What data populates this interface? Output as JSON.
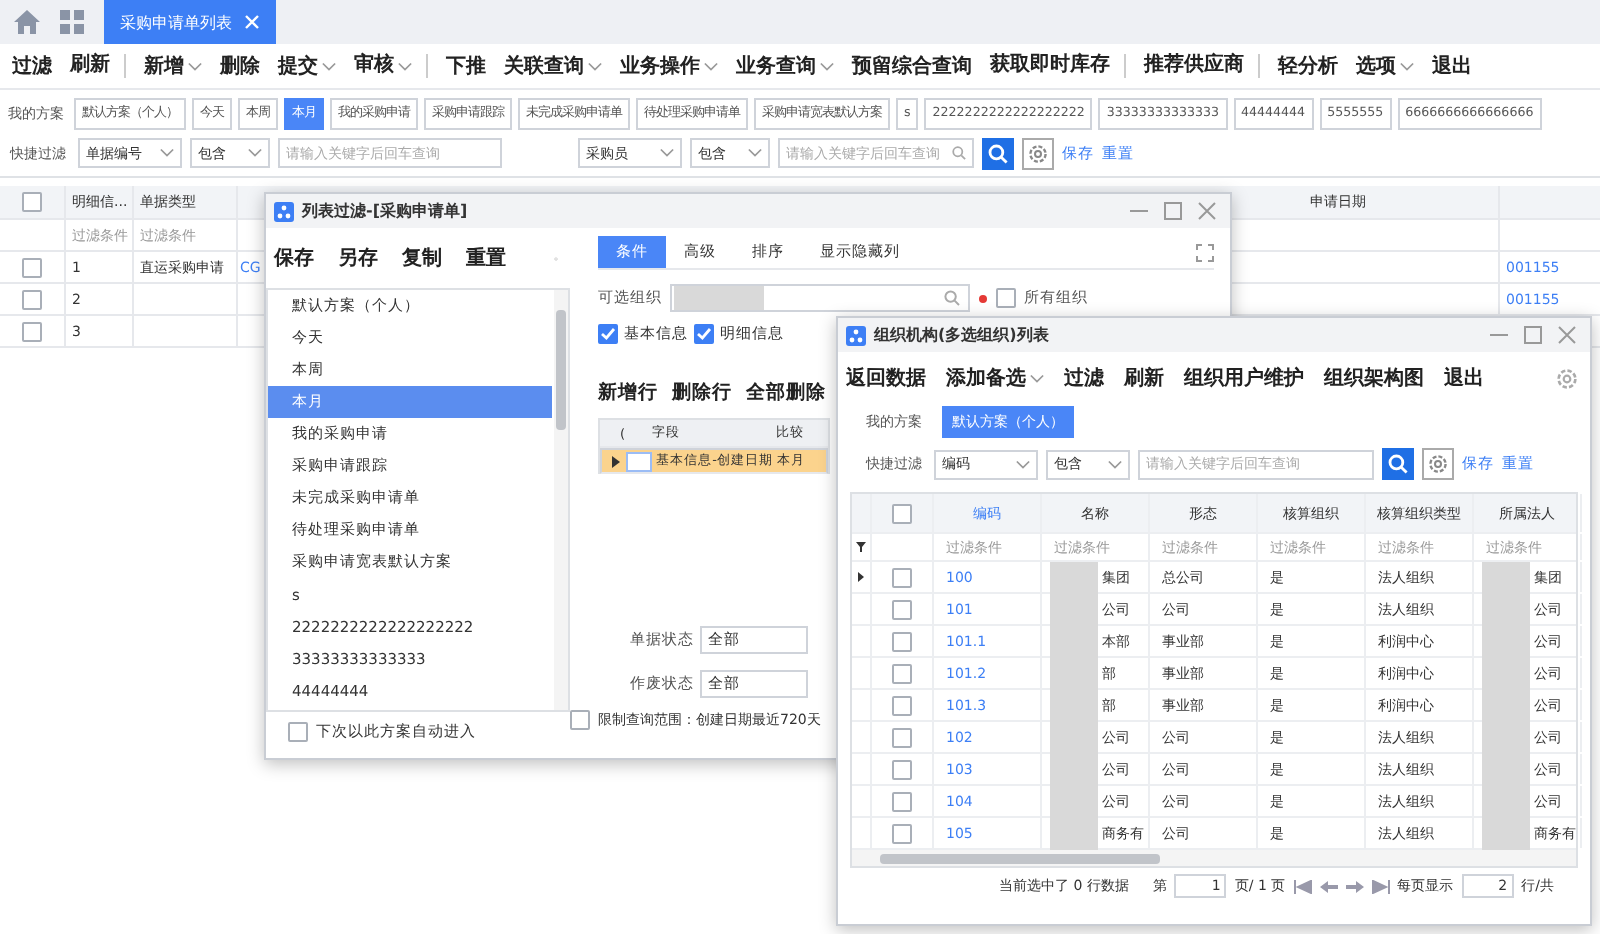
{
  "tabs": [
    {
      "label": "采购申请单列表",
      "selected": true,
      "closable": true
    }
  ],
  "toolbar": [
    {
      "label": "过滤",
      "dropdown": false,
      "separator_after": false
    },
    {
      "label": "刷新",
      "dropdown": false,
      "separator_after": true
    },
    {
      "label": "新增",
      "dropdown": true,
      "separator_after": false
    },
    {
      "label": "删除",
      "dropdown": false,
      "separator_after": false
    },
    {
      "label": "提交",
      "dropdown": true,
      "separator_after": false
    },
    {
      "label": "审核",
      "dropdown": true,
      "separator_after": true
    },
    {
      "label": "下推",
      "dropdown": false,
      "separator_after": false
    },
    {
      "label": "关联查询",
      "dropdown": true,
      "separator_after": false
    },
    {
      "label": "业务操作",
      "dropdown": true,
      "separator_after": false
    },
    {
      "label": "业务查询",
      "dropdown": true,
      "separator_after": false
    },
    {
      "label": "预留综合查询",
      "dropdown": false,
      "separator_after": false
    },
    {
      "label": "获取即时库存",
      "dropdown": false,
      "separator_after": true
    },
    {
      "label": "推荐供应商",
      "dropdown": false,
      "separator_after": true
    },
    {
      "label": "轻分析",
      "dropdown": false,
      "separator_after": false
    },
    {
      "label": "选项",
      "dropdown": true,
      "separator_after": false
    },
    {
      "label": "退出",
      "dropdown": false,
      "separator_after": false
    }
  ],
  "scheme_bar": {
    "label": "我的方案",
    "schemes": [
      {
        "label": "默认方案（个人）",
        "selected": false
      },
      {
        "label": "今天",
        "selected": false
      },
      {
        "label": "本周",
        "selected": false
      },
      {
        "label": "本月",
        "selected": true
      },
      {
        "label": "我的采购申请",
        "selected": false
      },
      {
        "label": "采购申请跟踪",
        "selected": false
      },
      {
        "label": "未完成采购申请单",
        "selected": false
      },
      {
        "label": "待处理采购申请单",
        "selected": false
      },
      {
        "label": "采购申请宽表默认方案",
        "selected": false
      },
      {
        "label": "s",
        "selected": false
      },
      {
        "label": "2222222222222222222",
        "selected": false
      },
      {
        "label": "33333333333333",
        "selected": false
      },
      {
        "label": "44444444",
        "selected": false
      },
      {
        "label": "5555555",
        "selected": false
      },
      {
        "label": "6666666666666666",
        "selected": false
      }
    ]
  },
  "quick_filter": {
    "label": "快捷过滤",
    "groups": [
      {
        "field": "单据编号",
        "operator": "包含",
        "placeholder": "请输入关键字后回车查询"
      },
      {
        "field": "采购员",
        "operator": "包含",
        "placeholder": "请输入关键字后回车查询"
      }
    ],
    "links": [
      "保存",
      "重置"
    ]
  },
  "grid": {
    "header_checked": false,
    "columns": [
      "明细信...",
      "单据类型"
    ],
    "right_column": "申请日期",
    "filter_row": [
      "过滤条件",
      "过滤条件"
    ],
    "rows": [
      {
        "no": "1",
        "type": "直运采购申请",
        "column_3": "CG",
        "date_value": "001155",
        "checked": false
      },
      {
        "no": "2",
        "date_value": "001155",
        "checked": false
      },
      {
        "no": "3",
        "checked": false
      }
    ]
  },
  "filter_dialog": {
    "title": "列表过滤-[采购申请单]",
    "toolbar": [
      "保存",
      "另存",
      "复制",
      "重置"
    ],
    "schemes": [
      {
        "label": "默认方案（个人）",
        "selected": false
      },
      {
        "label": "今天",
        "selected": false
      },
      {
        "label": "本周",
        "selected": false
      },
      {
        "label": "本月",
        "selected": true
      },
      {
        "label": "我的采购申请",
        "selected": false
      },
      {
        "label": "采购申请跟踪",
        "selected": false
      },
      {
        "label": "未完成采购申请单",
        "selected": false
      },
      {
        "label": "待处理采购申请单",
        "selected": false
      },
      {
        "label": "采购申请宽表默认方案",
        "selected": false
      },
      {
        "label": "s",
        "selected": false
      },
      {
        "label": "2222222222222222222",
        "selected": false
      },
      {
        "label": "33333333333333",
        "selected": false
      },
      {
        "label": "44444444",
        "selected": false
      }
    ],
    "auto_enter": {
      "label": "下次以此方案自动进入",
      "checked": false
    },
    "tabs": [
      {
        "label": "条件",
        "selected": true
      },
      {
        "label": "高级",
        "selected": false
      },
      {
        "label": "排序",
        "selected": false
      },
      {
        "label": "显示隐藏列",
        "selected": false
      }
    ],
    "org_label": "可选组织",
    "all_orgs": {
      "label": "所有组织",
      "checked": false
    },
    "info_checks": [
      {
        "label": "基本信息",
        "checked": true
      },
      {
        "label": "明细信息",
        "checked": true
      }
    ],
    "row_actions": [
      "新增行",
      "删除行",
      "全部删除"
    ],
    "condition_columns": [
      "(",
      "字段",
      "比较"
    ],
    "condition_rows": [
      {
        "field": "基本信息-创建日期",
        "compare": "本月",
        "selected": true
      }
    ],
    "status_fields": [
      {
        "label": "单据状态",
        "value": "全部"
      },
      {
        "label": "作废状态",
        "value": "全部"
      }
    ],
    "limit": {
      "label": "限制查询范围：创建日期最近720天",
      "checked": false
    }
  },
  "org_dialog": {
    "title": "组织机构(多选组织)列表",
    "toolbar": [
      {
        "label": "返回数据",
        "dropdown": false
      },
      {
        "label": "添加备选",
        "dropdown": true
      },
      {
        "label": "过滤",
        "dropdown": false
      },
      {
        "label": "刷新",
        "dropdown": false
      },
      {
        "label": "组织用户维护",
        "dropdown": false
      },
      {
        "label": "组织架构图",
        "dropdown": false
      },
      {
        "label": "退出",
        "dropdown": false
      }
    ],
    "scheme_label": "我的方案",
    "schemes": [
      {
        "label": "默认方案（个人）",
        "selected": true
      }
    ],
    "quick_filter": {
      "label": "快捷过滤",
      "field": "编码",
      "operator": "包含",
      "placeholder": "请输入关键字后回车查询",
      "links": [
        "保存",
        "重置"
      ]
    },
    "columns": [
      {
        "label": "编码",
        "selected": true
      },
      {
        "label": "名称",
        "selected": false
      },
      {
        "label": "形态",
        "selected": false
      },
      {
        "label": "核算组织",
        "selected": false
      },
      {
        "label": "核算组织类型",
        "selected": false
      },
      {
        "label": "所属法人",
        "selected": false
      }
    ],
    "header_checked": false,
    "filter_row": [
      "过滤条件",
      "过滤条件",
      "过滤条件",
      "过滤条件",
      "过滤条件",
      "过滤条件"
    ],
    "rows": [
      {
        "code": "100",
        "name": "集团",
        "form": "总公司",
        "accounting": "是",
        "org_type": "法人组织",
        "legal": "集团",
        "checked": false
      },
      {
        "code": "101",
        "name": "公司",
        "form": "公司",
        "accounting": "是",
        "org_type": "法人组织",
        "legal": "公司",
        "checked": false
      },
      {
        "code": "101.1",
        "name": "本部",
        "form": "事业部",
        "accounting": "是",
        "org_type": "利润中心",
        "legal": "公司",
        "checked": false
      },
      {
        "code": "101.2",
        "name": "部",
        "form": "事业部",
        "accounting": "是",
        "org_type": "利润中心",
        "legal": "公司",
        "checked": false
      },
      {
        "code": "101.3",
        "name": "部",
        "form": "事业部",
        "accounting": "是",
        "org_type": "利润中心",
        "legal": "公司",
        "checked": false
      },
      {
        "code": "102",
        "name": "公司",
        "form": "公司",
        "accounting": "是",
        "org_type": "法人组织",
        "legal": "公司",
        "checked": false
      },
      {
        "code": "103",
        "name": "公司",
        "form": "公司",
        "accounting": "是",
        "org_type": "法人组织",
        "legal": "公司",
        "checked": false
      },
      {
        "code": "104",
        "name": "公司",
        "form": "公司",
        "accounting": "是",
        "org_type": "法人组织",
        "legal": "公司",
        "checked": false
      },
      {
        "code": "105",
        "name": "商务有",
        "form": "公司",
        "accounting": "是",
        "org_type": "法人组织",
        "legal": "商务有",
        "checked": false
      }
    ],
    "footer": {
      "selected_text": "当前选中了 0 行数据",
      "page_prefix": "第",
      "page": "1",
      "page_suffix": "页/ 1 页",
      "per_page_label": "每页显示",
      "per_page": "2",
      "rows_suffix": "行/共"
    }
  }
}
